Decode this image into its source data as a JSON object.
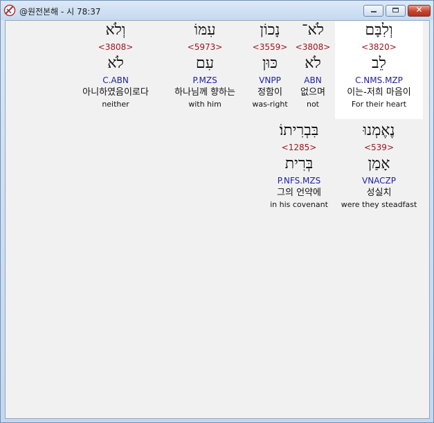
{
  "window": {
    "title": "@원전본해 - 시 78:37"
  },
  "rows": [
    [
      {
        "hebrew": "וְלִבָּם",
        "strong": "<3820>",
        "lemma": "לֵב",
        "morph": "C.NMS.MZP",
        "korean": "이는-저희 마음이",
        "english": "For their heart",
        "selected": true
      },
      {
        "hebrew": "לֹא־",
        "strong": "<3808>",
        "lemma": "לֹא",
        "morph": "ABN",
        "korean": "없으며",
        "english": "not"
      },
      {
        "hebrew": "נָכוֹן",
        "strong": "<3559>",
        "lemma": "כּוּן",
        "morph": "VNPP",
        "korean": "정함이",
        "english": "was-right"
      },
      {
        "hebrew": "עִמּוֹ",
        "strong": "<5973>",
        "lemma": "עִם",
        "morph": "P.MZS",
        "korean": "하나님께 향하는",
        "english": "with him"
      },
      {
        "hebrew": "וְלֹא",
        "strong": "<3808>",
        "lemma": "לֹא",
        "morph": "C.ABN",
        "korean": "아니하였음이로다",
        "english": "neither"
      }
    ],
    [
      {
        "hebrew": "נֶאֶמְנוּ",
        "strong": "<539>",
        "lemma": "אָמַן",
        "morph": "VNACZP",
        "korean": "성실치",
        "english": "were they steadfast"
      },
      {
        "hebrew": "בִּבְרִיתוֹ׃",
        "strong": "<1285>",
        "lemma": "בְּרִית",
        "morph": "P.NFS.MZS",
        "korean": "그의 언약에",
        "english": "in his covenant"
      }
    ]
  ]
}
